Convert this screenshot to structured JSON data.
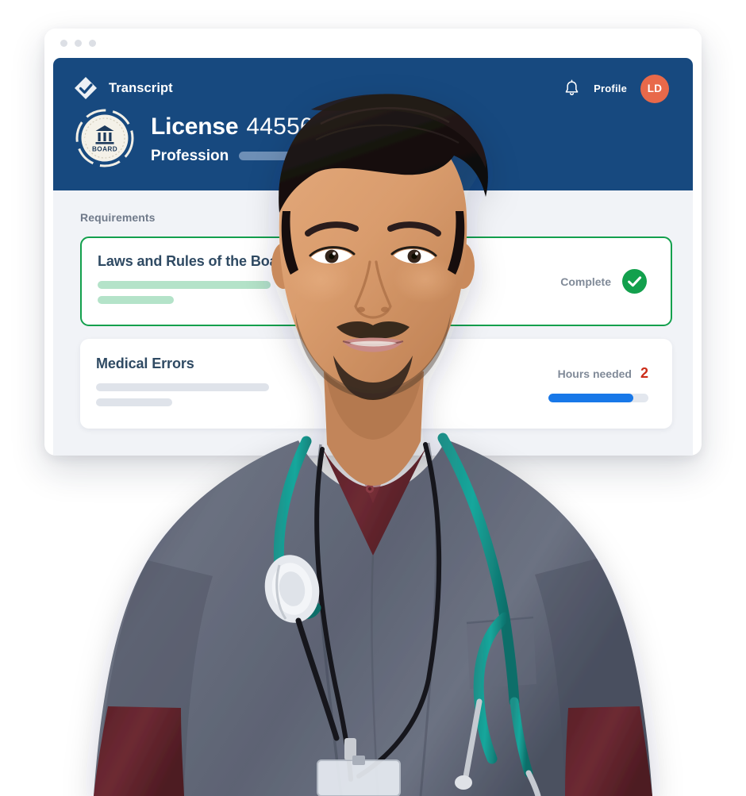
{
  "window": {
    "dots": [
      "dot-1",
      "dot-2",
      "dot-3"
    ]
  },
  "header": {
    "logo_icon": "diamond-check-logo-icon",
    "brand_name": "Transcript",
    "bell_icon": "bell-icon",
    "profile_label": "Profile",
    "avatar_initials": "LD",
    "avatar_color": "#e8694a",
    "background_color": "#17497f",
    "seal_icon": "board-seal-badge-icon",
    "seal_text": "BOARD",
    "license_word": "License",
    "license_number": "445566",
    "profession_word": "Profession",
    "profession_value_placeholder": ""
  },
  "main": {
    "section_title": "Requirements",
    "requirements": [
      {
        "title": "Laws and Rules of the Board",
        "state": "complete",
        "status_text": "Complete",
        "status_icon": "check-circle-icon",
        "accent_color": "#13a04d",
        "skeleton_color": "#b4e3c9"
      },
      {
        "title": "Medical Errors",
        "state": "in-progress",
        "hours_label": "Hours needed",
        "hours_value": "2",
        "hours_value_color": "#cc2c18",
        "progress_percent": 85,
        "progress_color": "#1878e8",
        "skeleton_color": "#dfe3ea"
      }
    ]
  },
  "photo": {
    "subject": "healthcare-professional-portrait",
    "description": "Smiling man in gray scrubs with teal stethoscope, maroon long-sleeve undershirt and ID lanyard"
  }
}
